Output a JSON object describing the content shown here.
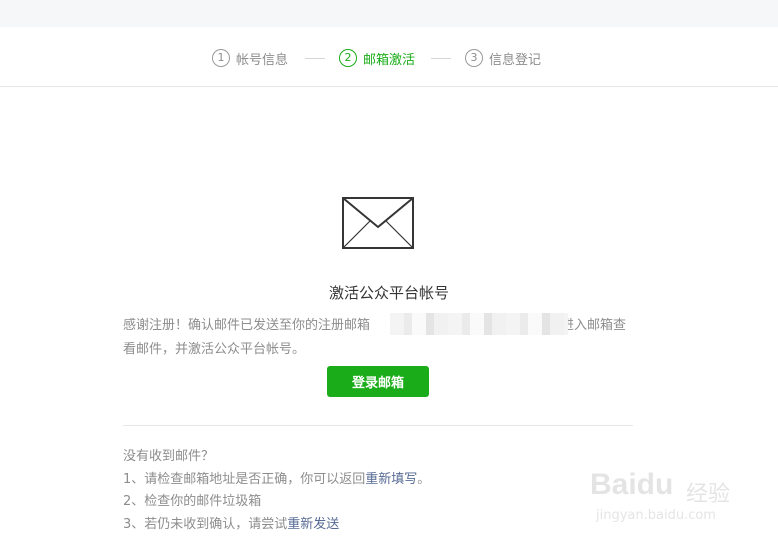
{
  "steps": [
    {
      "num": "1",
      "label": "帐号信息"
    },
    {
      "num": "2",
      "label": "邮箱激活"
    },
    {
      "num": "3",
      "label": "信息登记"
    }
  ],
  "main": {
    "title": "激活公众平台帐号",
    "desc_part1": "感谢注册！确认邮件已发送至你的注册邮箱",
    "desc_part2": "请进入邮箱查看邮件，并激活公众平台帐号。",
    "login_button": "登录邮箱"
  },
  "help": {
    "heading": "没有收到邮件？",
    "item1_text": "1、请检查邮箱地址是否正确，你可以返回",
    "item1_link": "重新填写",
    "item1_suffix": "。",
    "item2_text": "2、检查你的邮件垃圾箱",
    "item3_text": "3、若仍未收到确认，请尝试",
    "item3_link": "重新发送"
  },
  "watermark": {
    "logo": "Baidu",
    "cn": "经验",
    "url": "jingyan.baidu.com"
  },
  "colors": {
    "accent": "#1aad19",
    "link": "#576b95",
    "muted": "#8d8d8d"
  }
}
